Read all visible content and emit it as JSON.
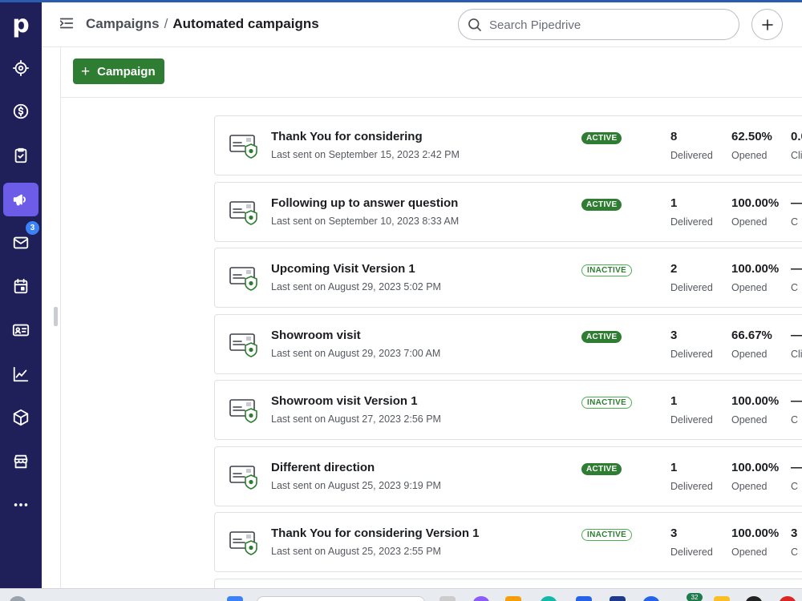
{
  "sidebar": {
    "logo": "p",
    "items": [
      {
        "name": "target-icon",
        "active": false
      },
      {
        "name": "dollar-icon",
        "active": false
      },
      {
        "name": "clipboard-check-icon",
        "active": false
      },
      {
        "name": "megaphone-icon",
        "active": true
      },
      {
        "name": "mail-icon",
        "active": false
      },
      {
        "name": "calendar-icon",
        "active": false
      },
      {
        "name": "contact-card-icon",
        "active": false
      },
      {
        "name": "chart-icon",
        "active": false
      },
      {
        "name": "box-icon",
        "active": false
      },
      {
        "name": "store-icon",
        "active": false
      },
      {
        "name": "more-icon",
        "active": false
      }
    ],
    "mail_badge": "3"
  },
  "header": {
    "breadcrumb_parent": "Campaigns",
    "breadcrumb_separator": "/",
    "breadcrumb_current": "Automated campaigns",
    "search_placeholder": "Search Pipedrive"
  },
  "toolbar": {
    "add_campaign_label": "Campaign"
  },
  "campaigns": [
    {
      "title": "Thank You for considering",
      "last_sent": "Last sent on September 15, 2023 2:42 PM",
      "status": "ACTIVE",
      "delivered": "8",
      "delivered_label": "Delivered",
      "opened": "62.50%",
      "opened_label": "Opened",
      "clicked": "0.0",
      "clicked_label": "Cli"
    },
    {
      "title": "Following up to answer question",
      "last_sent": "Last sent on September 10, 2023 8:33 AM",
      "status": "ACTIVE",
      "delivered": "1",
      "delivered_label": "Delivered",
      "opened": "100.00%",
      "opened_label": "Opened",
      "clicked": "—",
      "clicked_label": "C"
    },
    {
      "title": "Upcoming Visit Version 1",
      "last_sent": "Last sent on August 29, 2023 5:02 PM",
      "status": "INACTIVE",
      "delivered": "2",
      "delivered_label": "Delivered",
      "opened": "100.00%",
      "opened_label": "Opened",
      "clicked": "—",
      "clicked_label": "C"
    },
    {
      "title": "Showroom visit",
      "last_sent": "Last sent on August 29, 2023 7:00 AM",
      "status": "ACTIVE",
      "delivered": "3",
      "delivered_label": "Delivered",
      "opened": "66.67%",
      "opened_label": "Opened",
      "clicked": "—",
      "clicked_label": "Cli"
    },
    {
      "title": "Showroom visit Version 1",
      "last_sent": "Last sent on August 27, 2023 2:56 PM",
      "status": "INACTIVE",
      "delivered": "1",
      "delivered_label": "Delivered",
      "opened": "100.00%",
      "opened_label": "Opened",
      "clicked": "—",
      "clicked_label": "C"
    },
    {
      "title": "Different direction",
      "last_sent": "Last sent on August 25, 2023 9:19 PM",
      "status": "ACTIVE",
      "delivered": "1",
      "delivered_label": "Delivered",
      "opened": "100.00%",
      "opened_label": "Opened",
      "clicked": "—",
      "clicked_label": "C"
    },
    {
      "title": "Thank You for considering Version 1",
      "last_sent": "Last sent on August 25, 2023 2:55 PM",
      "status": "INACTIVE",
      "delivered": "3",
      "delivered_label": "Delivered",
      "opened": "100.00%",
      "opened_label": "Opened",
      "clicked": "3",
      "clicked_label": "C"
    }
  ],
  "taskbar": {
    "notification_count": "32"
  },
  "colors": {
    "sidebar_bg": "#1f1f5a",
    "sidebar_active": "#6c5ce7",
    "brand_green": "#2e7d32",
    "badge_blue": "#3b82f6"
  }
}
